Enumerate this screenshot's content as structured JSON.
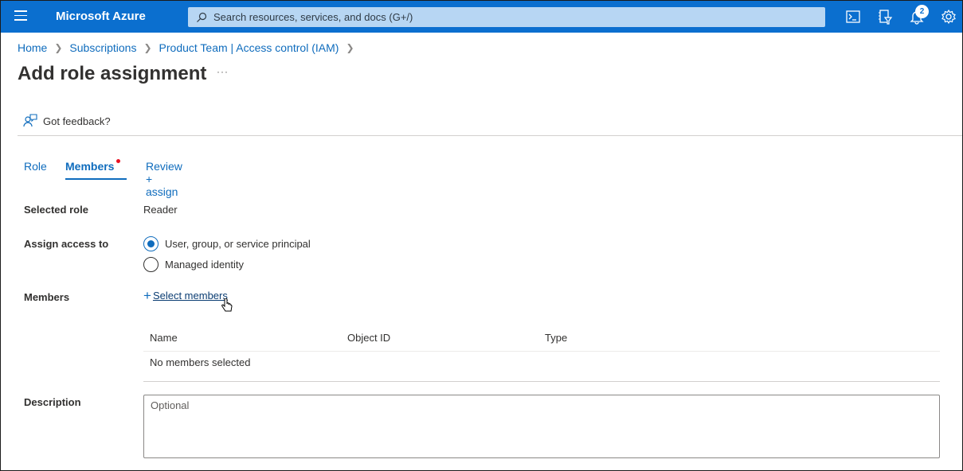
{
  "topbar": {
    "brand": "Microsoft Azure",
    "search_placeholder": "Search resources, services, and docs (G+/)",
    "notification_count": "2",
    "icons": [
      "menu-icon",
      "cloud-shell-icon",
      "directory-filter-icon",
      "notifications-icon",
      "settings-icon"
    ],
    "color": "#0b6fcf"
  },
  "breadcrumb": [
    {
      "label": "Home"
    },
    {
      "label": "Subscriptions"
    },
    {
      "label": "Product Team | Access control (IAM)"
    }
  ],
  "page": {
    "title": "Add role assignment",
    "more_label": "···",
    "feedback_label": "Got feedback?"
  },
  "tabs": [
    {
      "label": "Role",
      "active": false
    },
    {
      "label": "Members",
      "active": true,
      "has_indicator": true
    },
    {
      "label": "Review + assign",
      "active": false
    }
  ],
  "form": {
    "selected_role_label": "Selected role",
    "selected_role_value": "Reader",
    "assign_access_label": "Assign access to",
    "assign_options": [
      {
        "label": "User, group, or service principal",
        "selected": true
      },
      {
        "label": "Managed identity",
        "selected": false
      }
    ],
    "members_label": "Members",
    "select_members_label": "Select members",
    "table": {
      "columns": [
        "Name",
        "Object ID",
        "Type"
      ],
      "empty_text": "No members selected"
    },
    "description_label": "Description",
    "description_placeholder": "Optional",
    "description_value": ""
  },
  "colors": {
    "accent": "#0f6cbd",
    "indicator": "#e81123"
  }
}
